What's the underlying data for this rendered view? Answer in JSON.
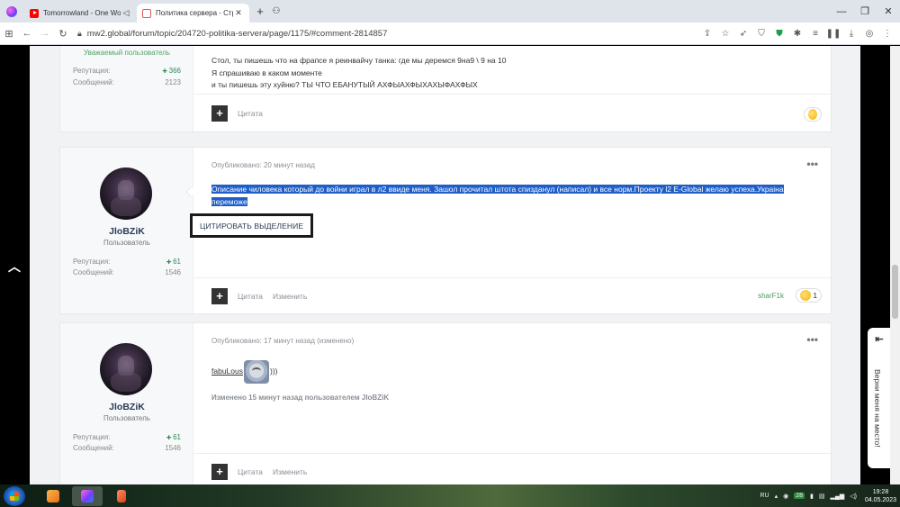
{
  "browser": {
    "tabs": [
      {
        "title": "Tomorrowland - One Wor",
        "icon": "youtube-icon",
        "active": false
      },
      {
        "title": "Политика сервера - Страни",
        "icon": "site-favicon",
        "active": true
      }
    ],
    "address": {
      "url_prefix": "mw2.global/forum/topic/204720-politika-servera/page/1175/#comment-2814857"
    }
  },
  "posts": [
    {
      "role": "Уважаемый пользователь",
      "reputation_label": "Репутация:",
      "reputation": "366",
      "messages_label": "Сообщений:",
      "messages": "2123",
      "lines": [
        "Стол, ты пишешь что на фрапсе я реинвайчу танка: где мы деремся 9на9 \\ 9 на 10",
        "Я спрашиваю в каком моменте",
        "и ты пишешь эту хуйню? ТЫ ЧТО ЕБАНУТЫЙ АХФЫАХФЫХАХЫФАХФЫХ"
      ],
      "quote_label": "Цитата"
    },
    {
      "username": "JloBZiK",
      "role": "Пользователь",
      "reputation_label": "Репутация:",
      "reputation": "61",
      "messages_label": "Сообщений:",
      "messages": "1546",
      "meta": "Опубликовано: 20 минут назад",
      "text_line1": "Описание чиловека который до войни играл в л2 ввиде меня. Зашол прочитал штота спизданул (написал) и все норм.Проекту l2 E-Global желаю успеха.Украіна",
      "text_line2": "переможе",
      "quote_selection_label": "ЦИТИРОВАТЬ ВЫДЕЛЕНИЕ",
      "quote_label": "Цитата",
      "edit_label": "Изменить",
      "reactor": "sharF1k",
      "reaction_count": "1"
    },
    {
      "username": "JloBZiK",
      "role": "Пользователь",
      "reputation_label": "Репутация:",
      "reputation": "61",
      "messages_label": "Сообщений:",
      "messages": "1546",
      "meta": "Опубликовано: 17 минут назад (изменено)",
      "text_word": "fabuLous",
      "text_suffix": ")))",
      "edited_note": "Изменено 15 минут назад пользователем JloBZiK",
      "quote_label": "Цитата",
      "edit_label": "Изменить"
    }
  ],
  "side_panel": {
    "label": "Верни меня на место!"
  },
  "taskbar": {
    "lang": "RU",
    "badge": "28",
    "time": "19:28",
    "date": "04.05.2023"
  }
}
